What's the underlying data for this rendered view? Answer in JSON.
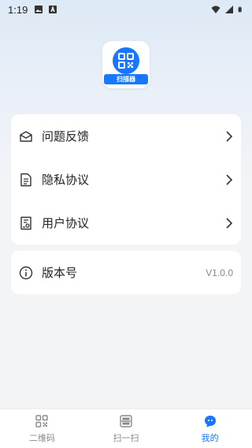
{
  "status_bar": {
    "time": "1:19",
    "left_icons": [
      "image-icon",
      "a-icon"
    ],
    "right_icons": [
      "wifi-icon",
      "signal-icon",
      "battery-icon"
    ]
  },
  "app": {
    "logo_text": "扫描器",
    "brand_color": "#1677ff"
  },
  "menu": {
    "items": [
      {
        "label": "问题反馈",
        "icon": "feedback-icon"
      },
      {
        "label": "隐私协议",
        "icon": "document-icon"
      },
      {
        "label": "用户协议",
        "icon": "user-agreement-icon"
      }
    ]
  },
  "version": {
    "label": "版本号",
    "value": "V1.0.0",
    "icon": "info-icon"
  },
  "tabs": [
    {
      "label": "二维码",
      "icon": "qrcode-icon",
      "active": false
    },
    {
      "label": "扫一扫",
      "icon": "scan-icon",
      "active": false
    },
    {
      "label": "我的",
      "icon": "profile-icon",
      "active": true
    }
  ]
}
